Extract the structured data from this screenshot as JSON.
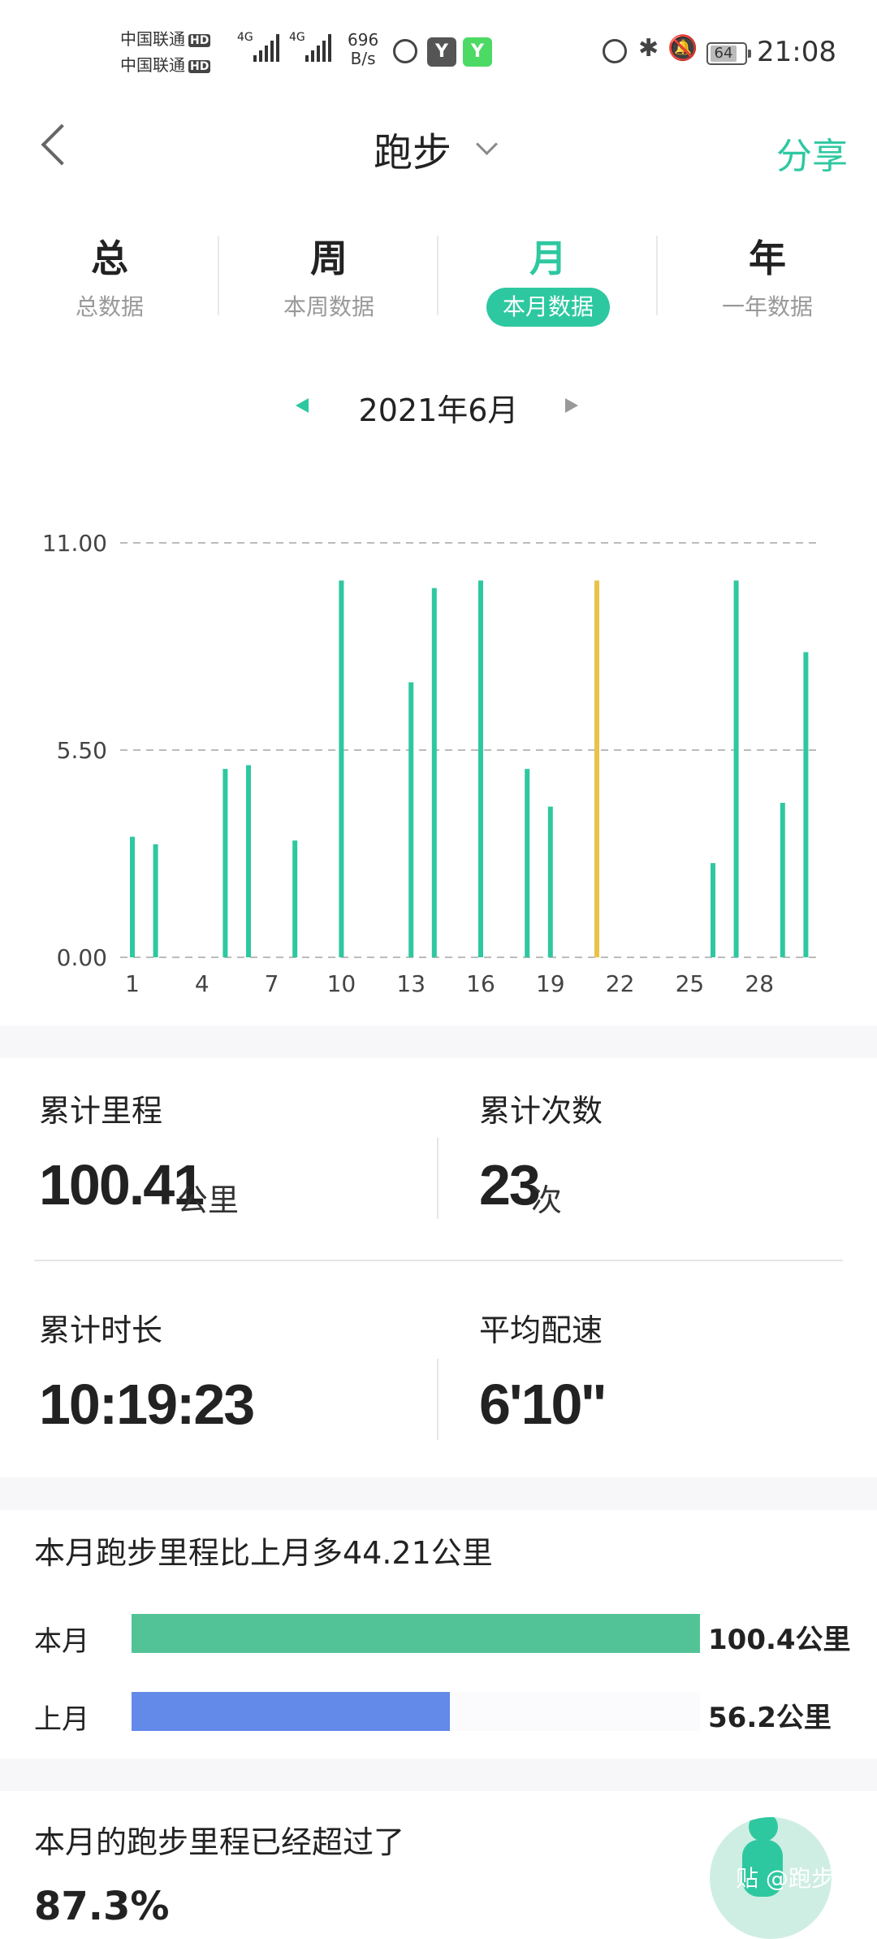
{
  "status_bar": {
    "carrier1": "中国联通",
    "carrier2": "中国联通",
    "hd": "HD",
    "net1": "4G",
    "net2": "4G",
    "speed_value": "696",
    "speed_unit": "B/s",
    "battery": "64",
    "time": "21:08"
  },
  "header": {
    "title": "跑步",
    "share": "分享"
  },
  "tabs": [
    {
      "big": "总",
      "small": "总数据",
      "active": false
    },
    {
      "big": "周",
      "small": "本周数据",
      "active": false
    },
    {
      "big": "月",
      "small": "本月数据",
      "active": true
    },
    {
      "big": "年",
      "small": "一年数据",
      "active": false
    }
  ],
  "period": "2021年6月",
  "chart_data": {
    "type": "bar",
    "title": "",
    "xlabel": "",
    "ylabel": "",
    "ylim": [
      0,
      11
    ],
    "y_ticks": [
      "0.00",
      "5.50",
      "11.00"
    ],
    "x_ticks": [
      "1",
      "4",
      "7",
      "10",
      "13",
      "16",
      "19",
      "22",
      "25",
      "28"
    ],
    "categories": [
      "1",
      "2",
      "3",
      "4",
      "5",
      "6",
      "7",
      "8",
      "9",
      "10",
      "11",
      "12",
      "13",
      "14",
      "15",
      "16",
      "17",
      "18",
      "19",
      "20",
      "21",
      "22",
      "23",
      "24",
      "25",
      "26",
      "27",
      "28",
      "29",
      "30"
    ],
    "values": [
      3.2,
      3.0,
      0,
      0,
      5.0,
      5.1,
      0,
      3.1,
      0,
      10.0,
      0,
      0,
      7.3,
      9.8,
      0,
      10.0,
      0,
      5.0,
      4.0,
      0,
      10.0,
      0,
      0,
      0,
      0,
      2.5,
      10.0,
      0,
      4.1,
      8.1
    ],
    "highlight_index": 20,
    "bar_color": "#2ec8a0",
    "highlight_color": "#e8c24a",
    "grid": "dashed"
  },
  "stats": {
    "distance_label": "累计里程",
    "distance_value": "100.41",
    "distance_unit": "公里",
    "count_label": "累计次数",
    "count_value": "23",
    "count_unit": "次",
    "duration_label": "累计时长",
    "duration_value": "10:19:23",
    "pace_label": "平均配速",
    "pace_value": "6'10''"
  },
  "compare": {
    "title": "本月跑步里程比上月多44.21公里",
    "this_label": "本月",
    "this_value": "100.4公里",
    "this_ratio": 1.0,
    "this_color": "#52c397",
    "last_label": "上月",
    "last_value": "56.2公里",
    "last_ratio": 0.5598,
    "last_color": "#6389e9"
  },
  "bottom": {
    "text": "本月的跑步里程已经超过了",
    "number": "87.3%",
    "watermark": "贴 @跑步"
  }
}
